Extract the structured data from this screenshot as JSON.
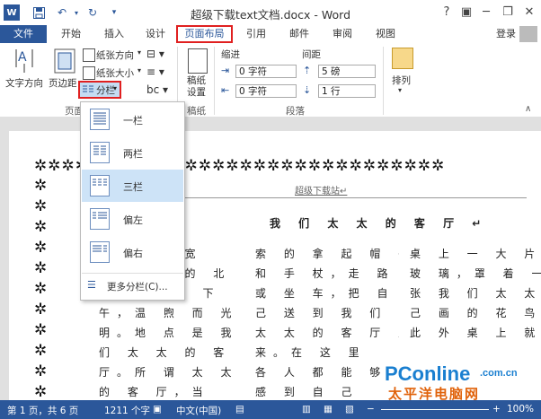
{
  "title": "超级下载text文档.docx - Word",
  "window_controls": [
    "?",
    "□",
    "─",
    "□",
    "✕"
  ],
  "tabs": [
    "文件",
    "开始",
    "插入",
    "设计",
    "页面布局",
    "引用",
    "邮件",
    "审阅",
    "视图"
  ],
  "login": "登录",
  "ribbon": {
    "text_direction": "文字方向",
    "margins": "页边距",
    "orientation": "纸张方向",
    "size": "纸张大小",
    "columns": "分栏",
    "page_setup_group": "页面设置",
    "draft_paper": "稿纸\n设置",
    "draft_group": "稿纸",
    "indent_label": "缩进",
    "spacing_label": "间距",
    "indent_left": "0 字符",
    "indent_right": "0 字符",
    "spacing_before": "5 磅",
    "spacing_after": "1 行",
    "paragraph_group": "段落",
    "arrange": "排列"
  },
  "columns_menu": {
    "items": [
      {
        "label": "一栏"
      },
      {
        "label": "两栏"
      },
      {
        "label": "三栏"
      },
      {
        "label": "偏左"
      },
      {
        "label": "偏右"
      }
    ],
    "more": "更多分栏(C)..."
  },
  "document": {
    "header_text": "超级下载站↵",
    "title": "我 们 太 太 的 客 厅 ↵",
    "col1": [
      "是 一 个 宽",
      "是 我 们 的 北",
      "，方 正 的 下",
      "午，温 煦 而 光",
      "明。地 点 是 我",
      "们 太 太 的 客",
      "厅。所 谓 太 太",
      "的 客 厅，当"
    ],
    "col2": [
      "索 的 拿 起 帽 子",
      "和 手 杖，走 路",
      "或 坐 车，把 自",
      "己 送 到 我 们",
      "太 太 的 客 厅 里",
      "来。在 这 里",
      "各 人 都 能 够",
      "感 到 自 己"
    ],
    "col3": [
      "桌 上 一 大 片 厚",
      "玻 璃，罩 着 一",
      "张 我 们 太 太 自",
      "己 画 的 花 鸟。",
      "此 外 桌 上 就 是",
      "",
      "",
      ""
    ]
  },
  "status": {
    "pages": "第 1 页，共 6 页",
    "words": "1211 个字",
    "lang": "中文(中国)",
    "zoom": "100%"
  },
  "watermark": {
    "brand": "PConline",
    "domain": ".com.cn",
    "cn": "太平洋电脑网"
  }
}
